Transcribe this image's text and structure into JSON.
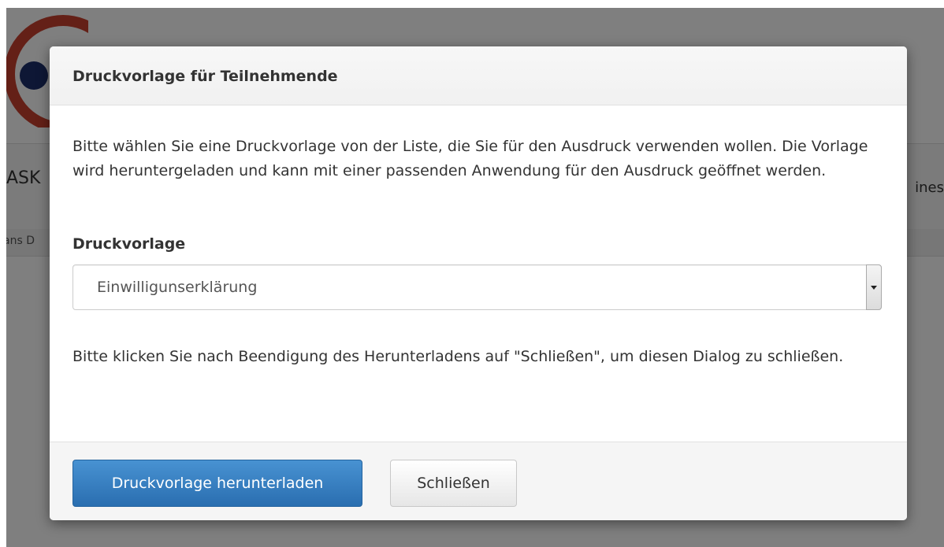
{
  "background": {
    "brand_text": "ASK",
    "right_text": "ines",
    "breadcrumb_text": "ans D"
  },
  "modal": {
    "title": "Druckvorlage für Teilnehmende",
    "intro": "Bitte wählen Sie eine Druckvorlage von der Liste, die Sie für den Ausdruck verwenden wollen. Die Vorlage wird heruntergeladen und kann mit einer passenden Anwendung für den Ausdruck geöffnet werden.",
    "field_label": "Druckvorlage",
    "select": {
      "selected": "Einwilligunserklärung"
    },
    "outro": "Bitte klicken Sie nach Beendigung des Herunterladens auf \"Schließen\", um diesen Dialog zu schließen.",
    "footer": {
      "download_label": "Druckvorlage herunterladen",
      "close_label": "Schließen"
    }
  },
  "colors": {
    "primary": "#337ab7",
    "logo_ring": "#c8402f",
    "logo_dot": "#1d2f6b"
  }
}
